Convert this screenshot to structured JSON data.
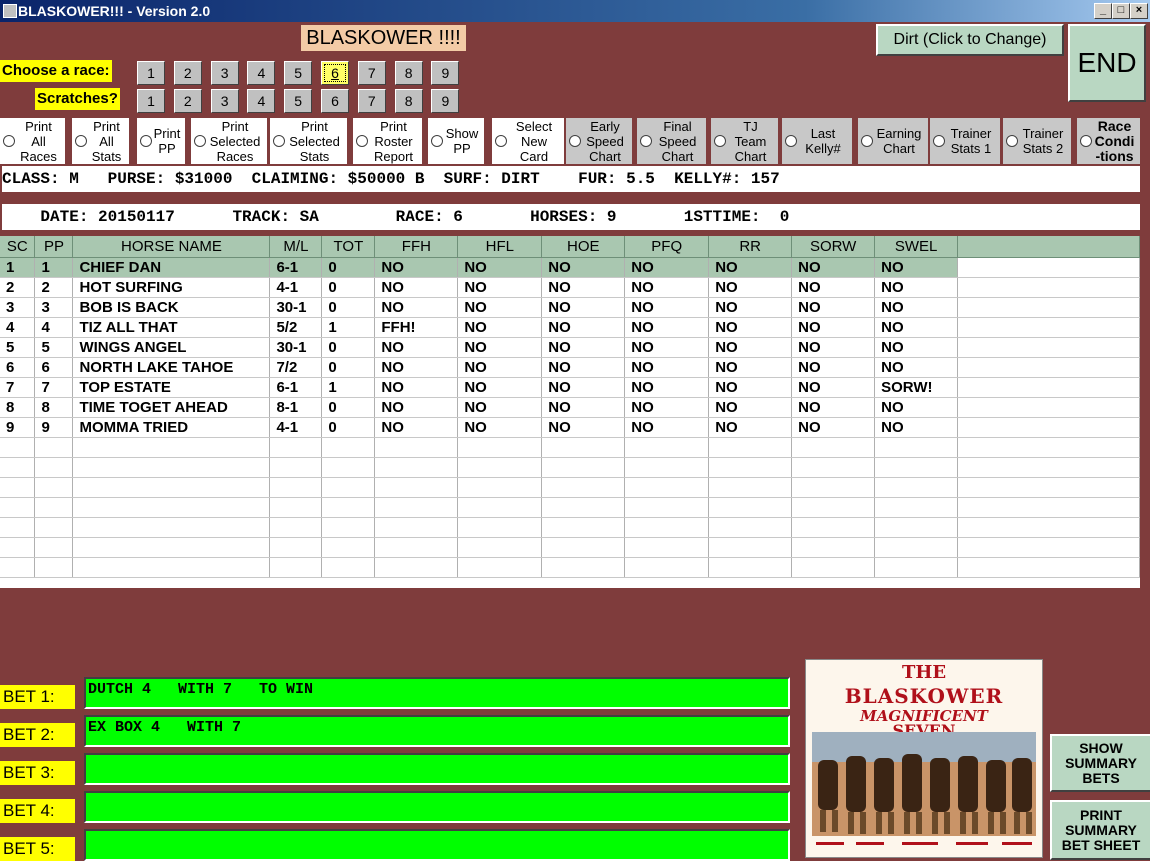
{
  "window": {
    "title": "BLASKOWER!!! - Version 2.0"
  },
  "banner": "BLASKOWER !!!!",
  "surface_button": "Dirt (Click to Change)",
  "end_button": "END",
  "choose_label": "Choose  a race:",
  "scratch_label": "Scratches?",
  "race_numbers": [
    "1",
    "2",
    "3",
    "4",
    "5",
    "6",
    "7",
    "8",
    "9"
  ],
  "selected_race": "6",
  "scratch_numbers": [
    "1",
    "2",
    "3",
    "4",
    "5",
    "6",
    "7",
    "8",
    "9"
  ],
  "options": [
    "Print\nAll\nRaces",
    "Print\nAll\nStats",
    "Print\nPP",
    "Print\nSelected\nRaces",
    "Print\nSelected\nStats",
    "Print\nRoster\nReport",
    "Show\nPP",
    "Select\nNew\nCard",
    "Early\nSpeed\nChart",
    "Final\nSpeed\nChart",
    "TJ\nTeam\nChart",
    "Last\nKelly#",
    "Earning\nChart",
    "Trainer\nStats 1",
    "Trainer\nStats 2",
    "Race\nCondi\n-tions"
  ],
  "race_info": "CLASS: M   PURSE: $31000  CLAIMING: $50000 B  SURF: DIRT    FUR: 5.5  KELLY#: 157",
  "race_header": "    DATE: 20150117      TRACK: SA        RACE: 6       HORSES: 9       1STTIME:  0",
  "table": {
    "headers": [
      "SC",
      "PP",
      "HORSE NAME",
      "M/L",
      "TOT",
      "FFH",
      "HFL",
      "HOE",
      "PFQ",
      "RR",
      "SORW",
      "SWEL"
    ],
    "rows": [
      [
        "1",
        "1",
        "CHIEF DAN",
        "6-1",
        "0",
        "NO",
        "NO",
        "NO",
        "NO",
        "NO",
        "NO",
        "NO"
      ],
      [
        "2",
        "2",
        "HOT SURFING",
        "4-1",
        "0",
        "NO",
        "NO",
        "NO",
        "NO",
        "NO",
        "NO",
        "NO"
      ],
      [
        "3",
        "3",
        "BOB IS BACK",
        "30-1",
        "0",
        "NO",
        "NO",
        "NO",
        "NO",
        "NO",
        "NO",
        "NO"
      ],
      [
        "4",
        "4",
        "TIZ ALL THAT",
        "5/2",
        "1",
        "FFH!",
        "NO",
        "NO",
        "NO",
        "NO",
        "NO",
        "NO"
      ],
      [
        "5",
        "5",
        "WINGS ANGEL",
        "30-1",
        "0",
        "NO",
        "NO",
        "NO",
        "NO",
        "NO",
        "NO",
        "NO"
      ],
      [
        "6",
        "6",
        "NORTH LAKE TAHOE",
        "7/2",
        "0",
        "NO",
        "NO",
        "NO",
        "NO",
        "NO",
        "NO",
        "NO"
      ],
      [
        "7",
        "7",
        "TOP ESTATE",
        "6-1",
        "1",
        "NO",
        "NO",
        "NO",
        "NO",
        "NO",
        "NO",
        "SORW!"
      ],
      [
        "8",
        "8",
        "TIME TOGET AHEAD",
        "8-1",
        "0",
        "NO",
        "NO",
        "NO",
        "NO",
        "NO",
        "NO",
        "NO"
      ],
      [
        "9",
        "9",
        "MOMMA TRIED",
        "4-1",
        "0",
        "NO",
        "NO",
        "NO",
        "NO",
        "NO",
        "NO",
        "NO"
      ]
    ]
  },
  "bets": [
    {
      "label": "BET 1:",
      "value": "DUTCH 4   WITH 7   TO WIN"
    },
    {
      "label": "BET 2:",
      "value": "EX BOX 4   WITH 7"
    },
    {
      "label": "BET 3:",
      "value": ""
    },
    {
      "label": "BET 4:",
      "value": ""
    },
    {
      "label": "BET 5:",
      "value": ""
    }
  ],
  "logo": {
    "line1": "THE",
    "line2": "BLASKOWER",
    "line3": "MAGNIFICENT",
    "line4": "SEVEN"
  },
  "show_summary": "SHOW\nSUMMARY\nBETS",
  "print_summary": "PRINT\nSUMMARY\nBET SHEET",
  "colors": {
    "background": "#7f3c3c",
    "grid_header": "#a9c7b0",
    "bet_field": "#00ff00",
    "label": "#ffff00"
  }
}
